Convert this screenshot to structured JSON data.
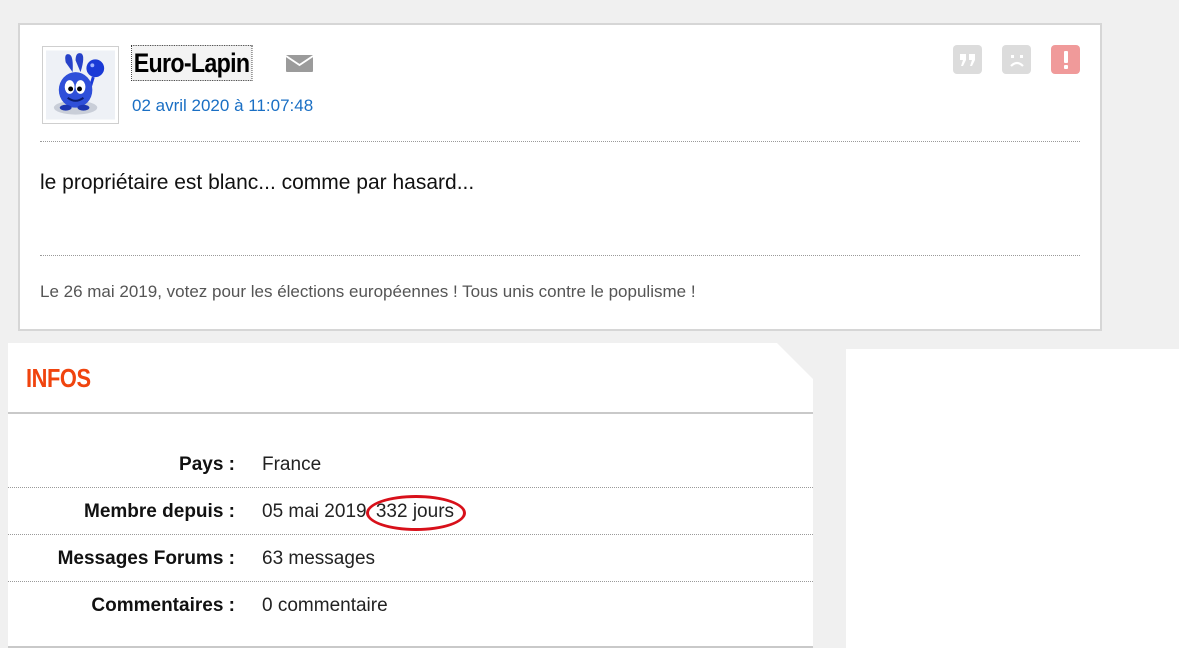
{
  "post": {
    "username": "Euro-Lapin",
    "date": "02 avril 2020 à 11:07:48",
    "body": "le propriétaire est blanc... comme par hasard...",
    "signature": "Le 26 mai 2019, votez pour les élections européennes ! Tous unis contre le populisme !",
    "icons": {
      "mail": "envelope-icon",
      "quote": "quote-icon",
      "sad": "sad-face-icon",
      "report": "exclamation-icon"
    },
    "colors": {
      "date_link": "#1a6fc4",
      "report_button": "#f09a9a",
      "neutral_button": "#dcdcdc"
    }
  },
  "infos": {
    "title": "INFOS",
    "title_color": "#f0440e",
    "rows": [
      {
        "label": "Pays :",
        "value": "France"
      },
      {
        "label": "Membre depuis :",
        "value": "05 mai 2019",
        "highlight": "332 jours"
      },
      {
        "label": "Messages Forums :",
        "value": "63 messages"
      },
      {
        "label": "Commentaires :",
        "value": "0 commentaire"
      }
    ],
    "highlight_color": "#d8101a"
  }
}
